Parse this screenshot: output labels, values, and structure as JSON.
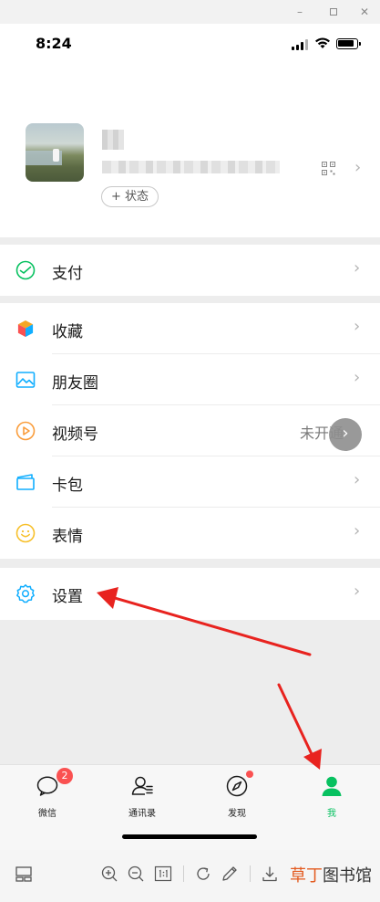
{
  "window": {
    "minimize_label": "–",
    "close_label": "✕"
  },
  "status_bar": {
    "time": "8:24"
  },
  "profile": {
    "status_button": "+ 状态"
  },
  "menu": {
    "pay": {
      "label": "支付",
      "icon": "wechat-pay-icon"
    },
    "favorites": {
      "label": "收藏",
      "icon": "cube-icon"
    },
    "moments": {
      "label": "朋友圈",
      "icon": "photo-icon"
    },
    "channels": {
      "label": "视频号",
      "icon": "play-circle-icon",
      "right_text": "未开通"
    },
    "cards": {
      "label": "卡包",
      "icon": "wallet-icon"
    },
    "stickers": {
      "label": "表情",
      "icon": "smile-icon"
    },
    "settings": {
      "label": "设置",
      "icon": "gear-icon"
    }
  },
  "tabs": [
    {
      "label": "微信",
      "icon": "chat-icon",
      "badge": "2"
    },
    {
      "label": "通讯录",
      "icon": "contacts-icon"
    },
    {
      "label": "发现",
      "icon": "compass-icon"
    },
    {
      "label": "我",
      "icon": "person-icon",
      "active": true
    }
  ],
  "viewer_toolbar": {
    "brand_part1": "草丁",
    "brand_part2": "图书馆"
  },
  "colors": {
    "accent": "#07c160",
    "badge": "#fa5151",
    "arrow": "#e8231f",
    "brand": "#e35a1f"
  }
}
